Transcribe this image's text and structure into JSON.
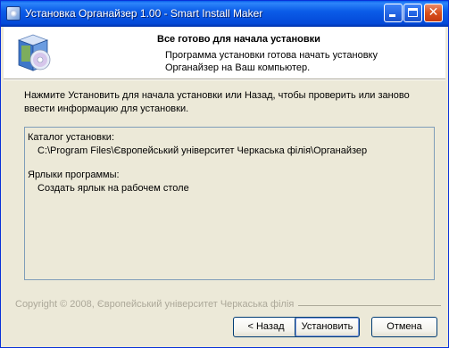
{
  "window": {
    "title": "Установка Органайзер 1.00 - Smart Install Maker"
  },
  "header": {
    "title": "Все готово для начала установки",
    "subtitle_line1": "Программа установки готова начать установку",
    "subtitle_line2": "Органайзер на Ваш компьютер."
  },
  "intro": {
    "line1": "Нажмите Установить для начала установки или Назад, чтобы проверить или заново",
    "line2": "ввести информацию для установки."
  },
  "summary": {
    "dir_label": "Каталог установки:",
    "dir_value": "C:\\Program Files\\Європейський університет Черкаська філія\\Органайзер",
    "shortcuts_label": "Ярлыки программы:",
    "shortcuts_value": "Создать ярлык на рабочем столе"
  },
  "footer": {
    "copyright": "Copyright © 2008, Європейський університет Черкаська філія"
  },
  "buttons": {
    "back": "< Назад",
    "install": "Установить",
    "cancel": "Отмена"
  },
  "colors": {
    "titlebar": "#0349D8",
    "dialog_bg": "#ECE9D8",
    "header_bg": "#FFFFFF",
    "copyright_text": "#ACA899"
  },
  "icons": {
    "title": "installer-app-icon",
    "header": "software-box-cd-icon"
  }
}
